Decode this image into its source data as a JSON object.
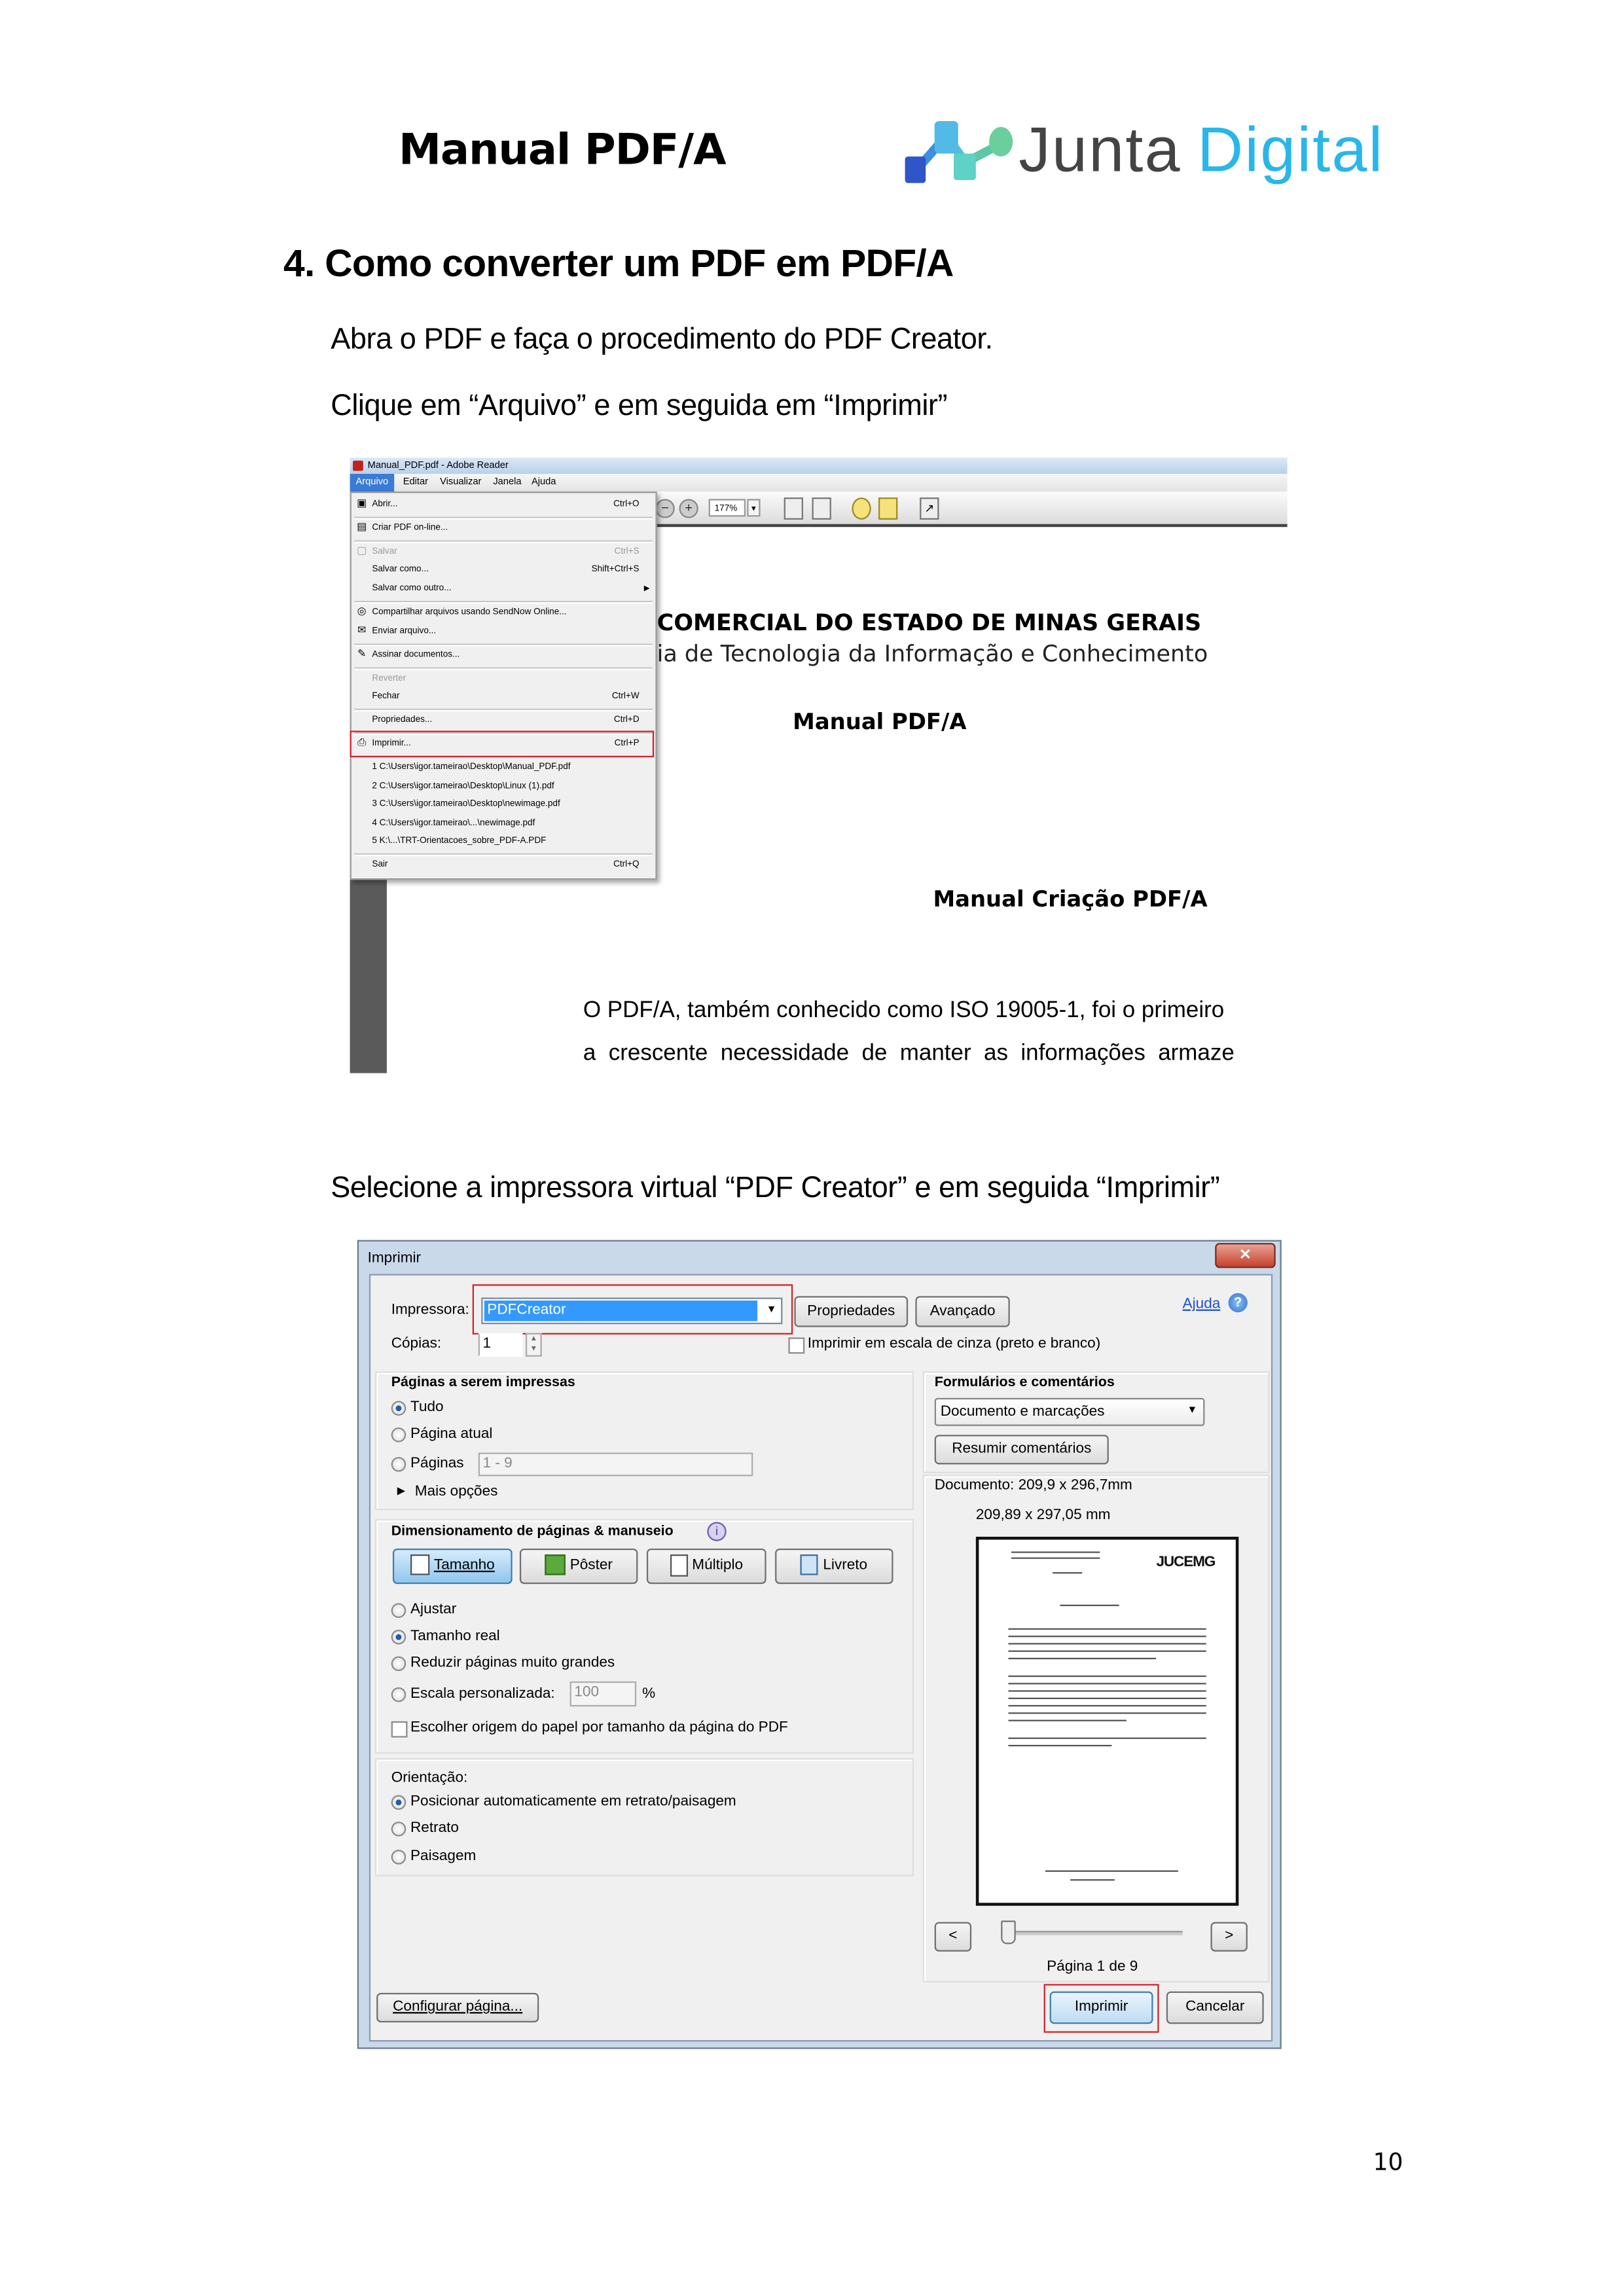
{
  "header": {
    "title": "Manual PDF/A",
    "logo": {
      "text_part1": "Junta",
      "text_part2": "Digital",
      "color_part1": "#444444",
      "color_part2": "#29b6e8"
    }
  },
  "section": {
    "heading": "4.  Como converter um PDF em PDF/A",
    "step1": "Abra o PDF e faça o procedimento do PDF Creator.",
    "step2": "Clique em “Arquivo” e em seguida em “Imprimir”",
    "step3": "Selecione a impressora virtual “PDF Creator” e em seguida “Imprimir”"
  },
  "adobe_reader": {
    "window_title": "Manual_PDF.pdf - Adobe Reader",
    "menubar": [
      "Arquivo",
      "Editar",
      "Visualizar",
      "Janela",
      "Ajuda"
    ],
    "zoom_value": "177%",
    "file_menu": [
      {
        "label": "Abrir...",
        "shortcut": "Ctrl+O",
        "icon": "open-folder-icon"
      },
      {
        "label": "Criar PDF on-line...",
        "shortcut": "",
        "icon": "create-pdf-icon"
      },
      {
        "label": "Salvar",
        "shortcut": "Ctrl+S",
        "icon": "save-icon",
        "disabled": true
      },
      {
        "label": "Salvar como...",
        "shortcut": "Shift+Ctrl+S"
      },
      {
        "label": "Salvar como outro...",
        "shortcut": "",
        "submenu": true
      },
      {
        "label": "Compartilhar arquivos usando SendNow Online...",
        "shortcut": "",
        "icon": "share-icon"
      },
      {
        "label": "Enviar arquivo...",
        "shortcut": "",
        "icon": "mail-icon"
      },
      {
        "label": "Assinar documentos...",
        "shortcut": "",
        "icon": "sign-icon"
      },
      {
        "label": "Reverter",
        "shortcut": "",
        "disabled": true
      },
      {
        "label": "Fechar",
        "shortcut": "Ctrl+W"
      },
      {
        "label": "Propriedades...",
        "shortcut": "Ctrl+D"
      },
      {
        "label": "Imprimir...",
        "shortcut": "Ctrl+P",
        "icon": "printer-icon",
        "highlighted": true
      },
      {
        "label": "1 C:\\Users\\igor.tameirao\\Desktop\\Manual_PDF.pdf",
        "shortcut": ""
      },
      {
        "label": "2 C:\\Users\\igor.tameirao\\Desktop\\Linux (1).pdf",
        "shortcut": ""
      },
      {
        "label": "3 C:\\Users\\igor.tameirao\\Desktop\\newimage.pdf",
        "shortcut": ""
      },
      {
        "label": "4 C:\\Users\\igor.tameirao\\...\\newimage.pdf",
        "shortcut": ""
      },
      {
        "label": "5 K:\\...\\TRT-Orientacoes_sobre_PDF-A.PDF",
        "shortcut": ""
      },
      {
        "label": "Sair",
        "shortcut": "Ctrl+Q"
      }
    ],
    "document": {
      "line1": "COMERCIAL DO ESTADO DE MINAS GERAIS",
      "line2": "ia de Tecnologia da Informação e Conhecimento",
      "title": "Manual PDF/A",
      "subtitle": "Manual Criação PDF/A",
      "para1": "O PDF/A, também conhecido como ISO 19005-1, foi o primeiro",
      "para2": "a  crescente  necessidade  de  manter  as  informações  armaze"
    }
  },
  "print_dialog": {
    "title": "Imprimir",
    "printer_label": "Impressora:",
    "printer_value": "PDFCreator",
    "properties_button": "Propriedades",
    "advanced_button": "Avançado",
    "help_link": "Ajuda",
    "copies_label": "Cópias:",
    "copies_value": "1",
    "grayscale_label": "Imprimir em escala de cinza (preto e branco)",
    "grayscale_checked": false,
    "pages_group": {
      "title": "Páginas a serem impressas",
      "all": "Tudo",
      "current": "Página atual",
      "pages": "Páginas",
      "pages_value": "1 - 9",
      "more": "Mais opções",
      "selected": "Tudo"
    },
    "sizing_group": {
      "title": "Dimensionamento de páginas & manuseio",
      "tabs": [
        "Tamanho",
        "Pôster",
        "Múltiplo",
        "Livreto"
      ],
      "active_tab": "Tamanho",
      "fit": "Ajustar",
      "actual": "Tamanho real",
      "shrink": "Reduzir páginas muito grandes",
      "custom": "Escala personalizada:",
      "custom_value": "100",
      "percent": "%",
      "paper_source": "Escolher origem do papel por tamanho da página do PDF",
      "selected": "Tamanho real"
    },
    "orientation_group": {
      "title": "Orientação:",
      "auto": "Posicionar automaticamente em retrato/paisagem",
      "portrait": "Retrato",
      "landscape": "Paisagem",
      "selected": "Posicionar automaticamente em retrato/paisagem"
    },
    "comments_group": {
      "title": "Formulários e comentários",
      "select_value": "Documento e marcações",
      "summarize_button": "Resumir comentários"
    },
    "preview": {
      "document_size": "Documento: 209,9 x 296,7mm",
      "paper_size": "209,89 x 297,05 mm",
      "logo_text": "JUCEMG",
      "page_info": "Página 1 de 9",
      "prev": "<",
      "next": ">"
    },
    "page_setup_button": "Configurar página...",
    "print_button": "Imprimir",
    "cancel_button": "Cancelar",
    "highlight_color": "#d6202a",
    "selection_color": "#3399ff"
  },
  "page_number": "10"
}
